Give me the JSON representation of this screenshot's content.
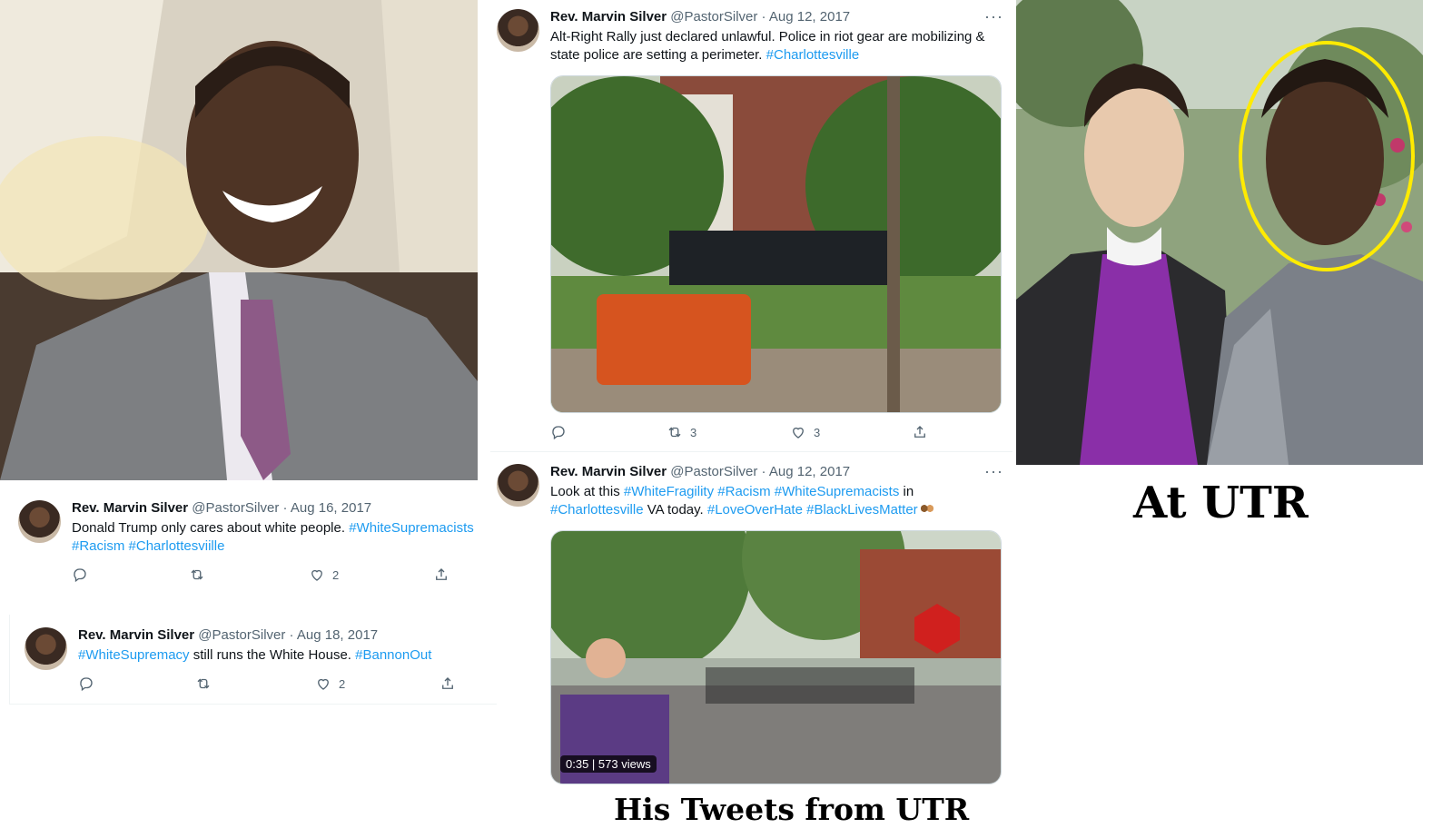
{
  "tweets": {
    "t1": {
      "name": "Rev. Marvin Silver",
      "meta": "@PastorSilver · Aug 12, 2017",
      "text_plain_1": "Alt-Right Rally just declared unlawful. Police in riot gear are mobilizing &",
      "text_plain_2": "state police are setting a perimeter. ",
      "tag_1": "#Charlottesville",
      "more": "···",
      "retweets": "3",
      "likes": "3"
    },
    "t2": {
      "name": "Rev. Marvin Silver",
      "meta": "@PastorSilver · Aug 12, 2017",
      "text_1": "Look at this ",
      "tag_1": "#WhiteFragility",
      "tag_2": "#Racism",
      "tag_3": "#WhiteSupremacists",
      "text_2": " in",
      "tag_4": "#Charlottesville",
      "text_3": " VA today. ",
      "tag_5": "#LoveOverHate",
      "tag_6": "#BlackLivesMatter",
      "more": "···",
      "video_time": "0:35",
      "video_views": "573 views"
    },
    "t3": {
      "name": "Rev. Marvin Silver",
      "meta": "@PastorSilver · Aug 16, 2017",
      "text_1": "Donald Trump only cares about white people. ",
      "tag_1": "#WhiteSupremacists",
      "tag_2": "#Racism",
      "tag_3": "#Charlottesviille",
      "likes": "2"
    },
    "t4": {
      "name": "Rev. Marvin Silver",
      "meta": "@PastorSilver · Aug 18, 2017",
      "tag_1": "#WhiteSupremacy",
      "text_1": " still runs the White House. ",
      "tag_2": "#BannonOut",
      "likes": "2"
    }
  },
  "captions": {
    "center": "His Tweets from UTR",
    "right": "At UTR"
  },
  "colors": {
    "link": "#1d9bf0",
    "highlight_circle": "#ffeb00"
  },
  "icons": [
    "reply-icon",
    "retweet-icon",
    "like-icon",
    "share-icon",
    "more-icon"
  ]
}
